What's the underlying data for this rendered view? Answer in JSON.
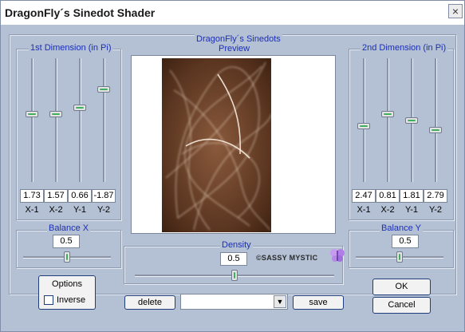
{
  "window": {
    "title": "DragonFly´s Sinedot Shader",
    "close_symbol": "×"
  },
  "left_group": {
    "title": "1st Dimension (in Pi)",
    "sliders": [
      {
        "label": "X-1",
        "value": "1.73",
        "level": 0.55
      },
      {
        "label": "X-2",
        "value": "1.57",
        "level": 0.55
      },
      {
        "label": "Y-1",
        "value": "0.66",
        "level": 0.6
      },
      {
        "label": "Y-2",
        "value": "-1.87",
        "level": 0.75
      }
    ]
  },
  "right_group": {
    "title": "2nd Dimension (in Pi)",
    "sliders": [
      {
        "label": "X-1",
        "value": "2.47",
        "level": 0.45
      },
      {
        "label": "X-2",
        "value": "0.81",
        "level": 0.55
      },
      {
        "label": "Y-1",
        "value": "1.81",
        "level": 0.5
      },
      {
        "label": "Y-2",
        "value": "2.79",
        "level": 0.42
      }
    ]
  },
  "preview": {
    "title_line1": "DragonFly´s Sinedots",
    "title_line2": "Preview"
  },
  "balance_x": {
    "title": "Balance X",
    "value": "0.5",
    "level": 0.5
  },
  "balance_y": {
    "title": "Balance Y",
    "value": "0.5",
    "level": 0.5
  },
  "density": {
    "title": "Density",
    "value": "0.5",
    "level": 0.5
  },
  "watermark": "©SASSY MYSTIC",
  "options": {
    "title": "Options",
    "inverse_label": "Inverse",
    "inverse_checked": false
  },
  "presets": {
    "delete_label": "delete",
    "save_label": "save",
    "selected": ""
  },
  "buttons": {
    "ok_label": "OK",
    "cancel_label": "Cancel"
  }
}
